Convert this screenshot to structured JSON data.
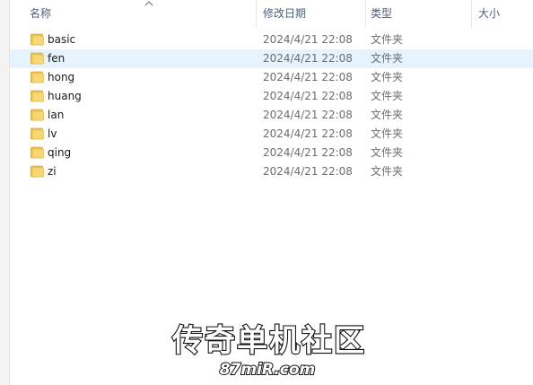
{
  "header": {
    "columns": [
      {
        "label": "名称"
      },
      {
        "label": "修改日期"
      },
      {
        "label": "类型"
      },
      {
        "label": "大小"
      }
    ]
  },
  "files": [
    {
      "name": "basic",
      "modified": "2024/4/21 22:08",
      "type": "文件夹",
      "selected": false
    },
    {
      "name": "fen",
      "modified": "2024/4/21 22:08",
      "type": "文件夹",
      "selected": true
    },
    {
      "name": "hong",
      "modified": "2024/4/21 22:08",
      "type": "文件夹",
      "selected": false
    },
    {
      "name": "huang",
      "modified": "2024/4/21 22:08",
      "type": "文件夹",
      "selected": false
    },
    {
      "name": "lan",
      "modified": "2024/4/21 22:08",
      "type": "文件夹",
      "selected": false
    },
    {
      "name": "lv",
      "modified": "2024/4/21 22:08",
      "type": "文件夹",
      "selected": false
    },
    {
      "name": "qing",
      "modified": "2024/4/21 22:08",
      "type": "文件夹",
      "selected": false
    },
    {
      "name": "zi",
      "modified": "2024/4/21 22:08",
      "type": "文件夹",
      "selected": false
    }
  ],
  "icons": {
    "folder": "folder-icon",
    "sort": "sort-ascending-icon"
  },
  "colors": {
    "selected_row": "#e5f3ff",
    "folder": "#f7d774",
    "header_text": "#4c607a"
  },
  "watermark": {
    "title": "传奇单机社区",
    "url": "87miR.com"
  }
}
